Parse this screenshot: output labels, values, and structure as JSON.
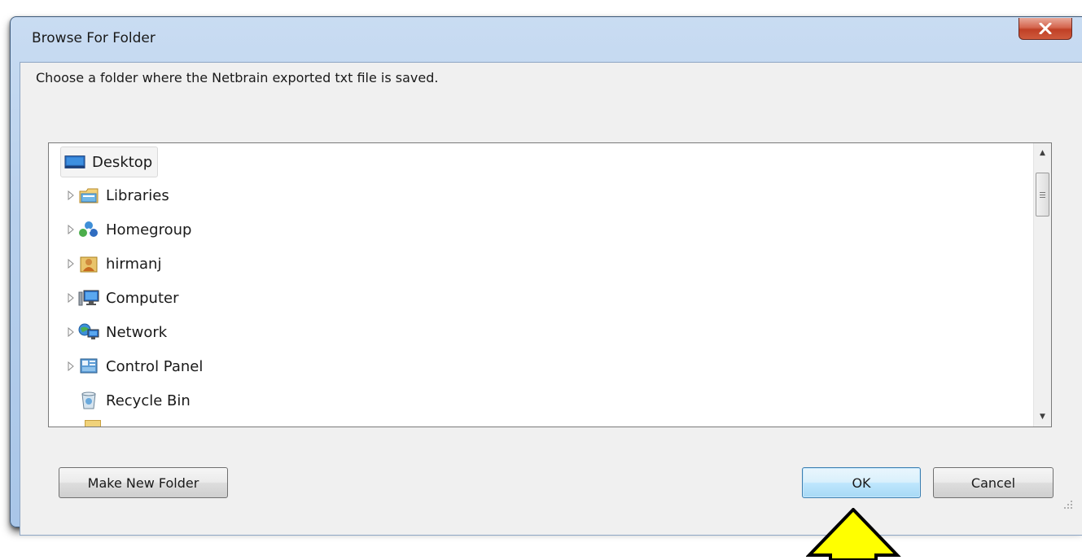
{
  "window": {
    "title": "Browse For Folder",
    "close_glyph": "X"
  },
  "instruction": "Choose a folder where the Netbrain exported txt file is saved.",
  "tree": {
    "items": [
      {
        "label": "Desktop",
        "icon": "desktop-icon",
        "expandable": false,
        "selected": true
      },
      {
        "label": "Libraries",
        "icon": "libraries-icon",
        "expandable": true,
        "selected": false
      },
      {
        "label": "Homegroup",
        "icon": "homegroup-icon",
        "expandable": true,
        "selected": false
      },
      {
        "label": "hirmanj",
        "icon": "user-folder-icon",
        "expandable": true,
        "selected": false
      },
      {
        "label": "Computer",
        "icon": "computer-icon",
        "expandable": true,
        "selected": false
      },
      {
        "label": "Network",
        "icon": "network-icon",
        "expandable": true,
        "selected": false
      },
      {
        "label": "Control Panel",
        "icon": "control-panel-icon",
        "expandable": true,
        "selected": false
      },
      {
        "label": "Recycle Bin",
        "icon": "recycle-bin-icon",
        "expandable": false,
        "selected": false
      }
    ]
  },
  "buttons": {
    "make_new_folder": "Make New Folder",
    "ok": "OK",
    "cancel": "Cancel"
  },
  "annotation": {
    "arrow_color": "#ffff00",
    "arrow_icon": "up-arrow-icon"
  },
  "colors": {
    "title_bar": "#b8d0ec",
    "close_button": "#c94a2e",
    "default_button": "#bee6fd"
  }
}
